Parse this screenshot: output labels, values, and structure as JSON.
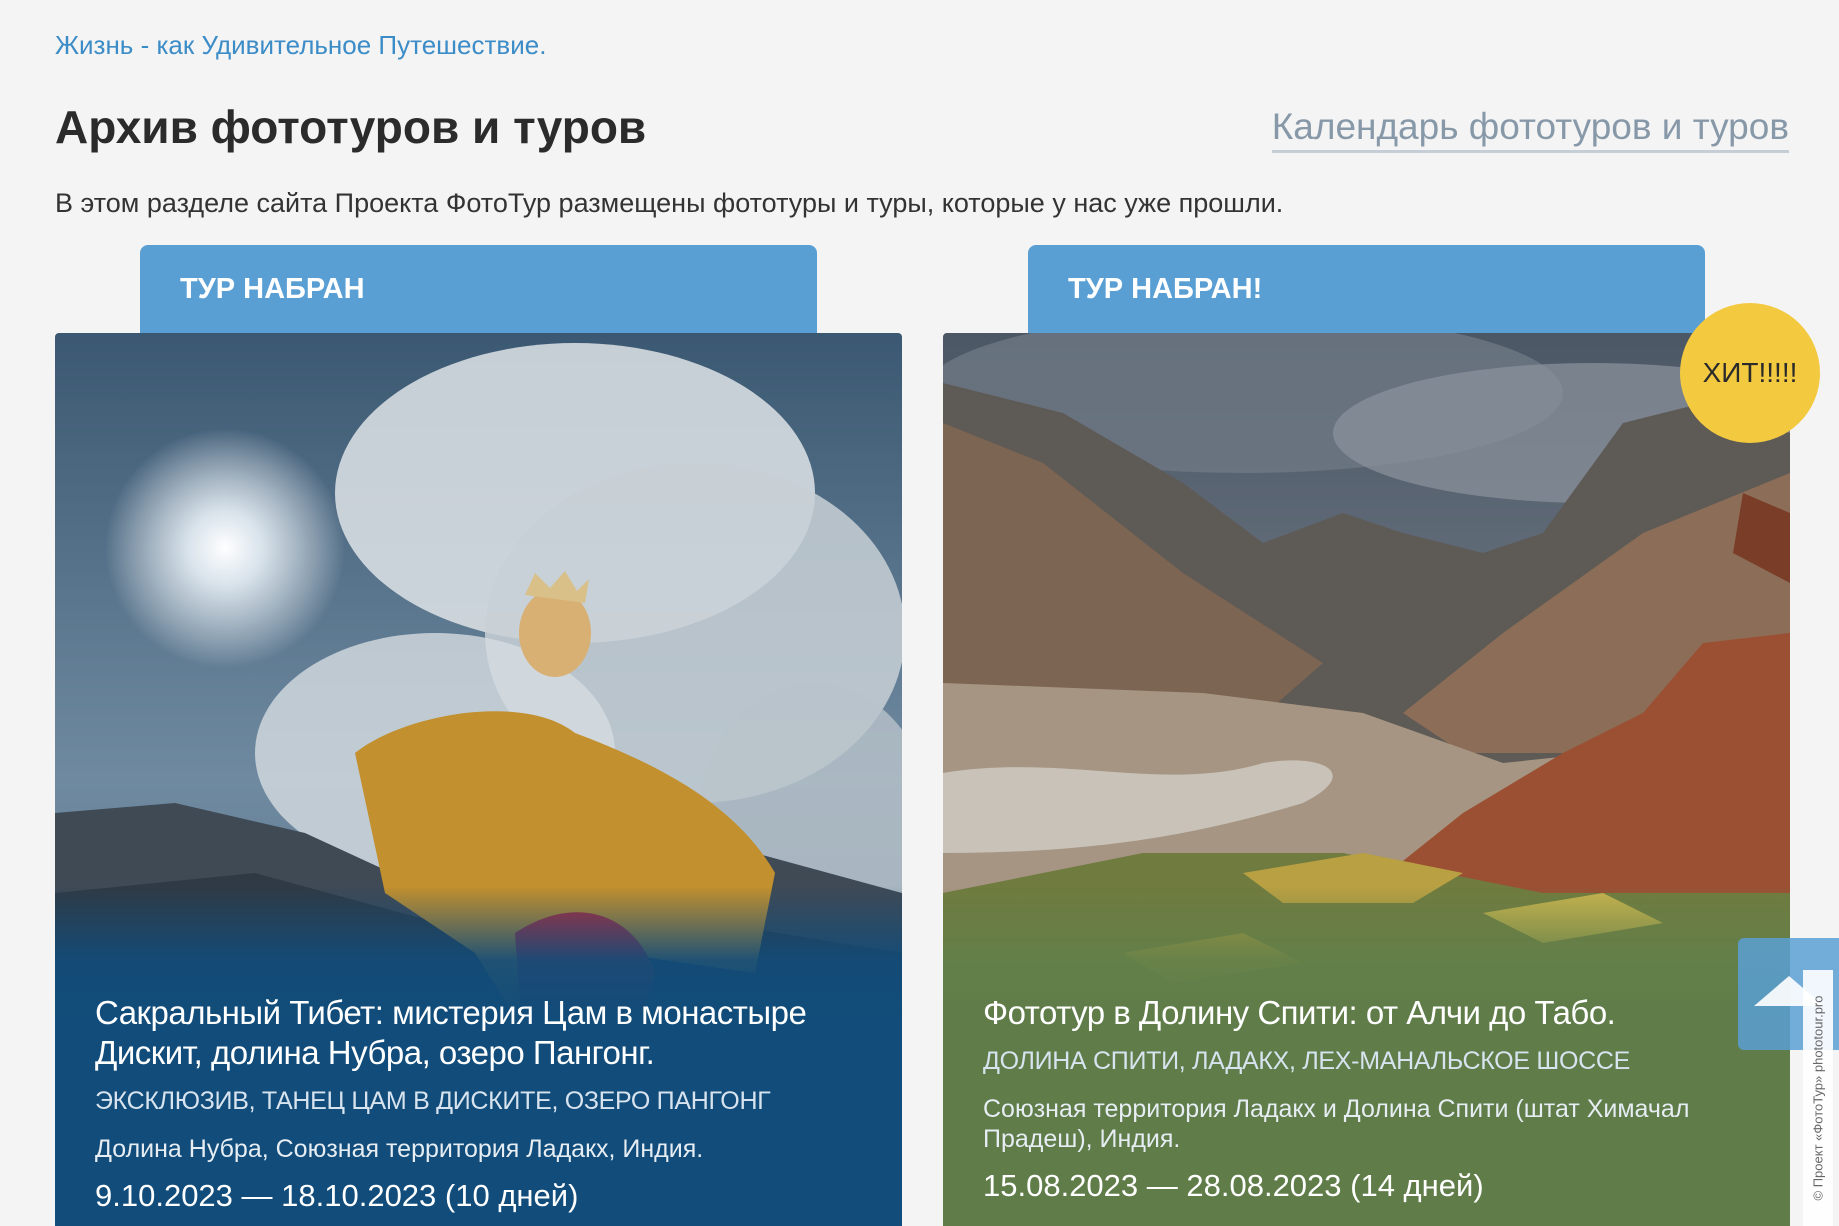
{
  "header": {
    "tagline": "Жизнь - как Удивительное Путешествие.",
    "page_title": "Архив фототуров и туров",
    "calendar_link": "Календарь фототуров и туров",
    "intro": "В этом разделе сайта Проекта ФотоТур размещены фототуры и туры, которые у нас уже прошли."
  },
  "cards": [
    {
      "tag": "ТУР НАБРАН",
      "title": "Сакральный Тибет: мистерия Цам в монастыре Дискит, долина Нубра, озеро Пангонг.",
      "subtitle": "ЭКСКЛЮЗИВ, ТАНЕЦ ЦАМ В ДИСКИТЕ, ОЗЕРО ПАНГОНГ",
      "location": "Долина Нубра, Союзная территория Ладакх, Индия.",
      "dates": "9.10.2023 — 18.10.2023 (10 дней)",
      "image": "cham-dancer-mask-sky-photo"
    },
    {
      "tag": "ТУР НАБРАН!",
      "badge": "ХИТ!!!!!",
      "title": "Фототур в Долину Спити: от Алчи до Табо.",
      "subtitle": "ДОЛИНА СПИТИ, ЛАДАКХ, ЛЕХ-МАНАЛЬСКОЕ ШОССЕ",
      "location": "Союзная территория Ладакх и Долина Спити (штат Химачал Прадеш), Индия.",
      "dates": "15.08.2023 — 28.08.2023 (14 дней)",
      "image": "spiti-valley-mountains-photo"
    }
  ],
  "scroll_top": {
    "icon": "arrow-up-icon"
  },
  "watermark": {
    "text": "© Проект «ФотоТур» phototour.pro"
  },
  "colors": {
    "link": "#3b8cc7",
    "tag_background": "#5a9fd4",
    "badge": "#f3c93f",
    "card1_overlay": "#114c7a",
    "card2_overlay": "#5f7c49"
  }
}
